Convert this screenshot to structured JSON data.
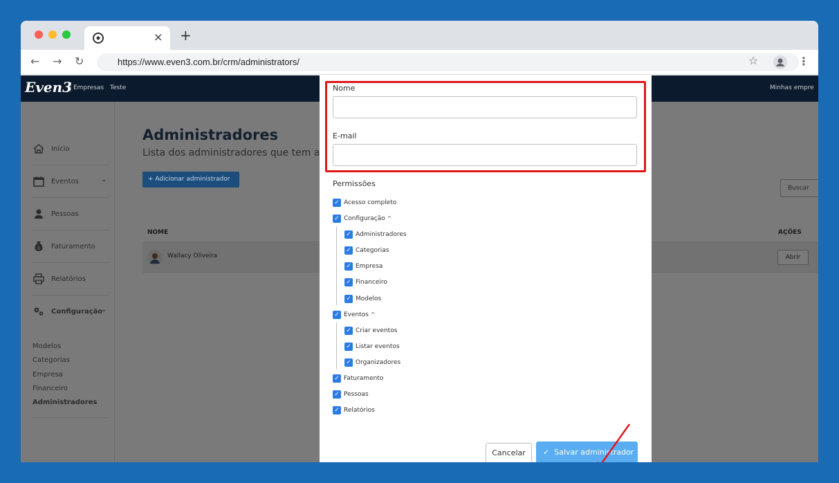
{
  "browser": {
    "url": "https://www.even3.com.br/crm/administrators/",
    "tab_close": "×",
    "new_tab": "+"
  },
  "header": {
    "logo": "Even3",
    "empresas": "Empresas",
    "teste": "Teste",
    "right_link": "Minhas empre"
  },
  "sidebar": {
    "items": [
      {
        "label": "Início",
        "icon": "home-icon"
      },
      {
        "label": "Eventos",
        "icon": "calendar-icon"
      },
      {
        "label": "Pessoas",
        "icon": "person-icon"
      },
      {
        "label": "Faturamento",
        "icon": "money-bag-icon"
      },
      {
        "label": "Relatórios",
        "icon": "printer-icon"
      },
      {
        "label": "Configuração",
        "icon": "gears-icon"
      }
    ],
    "sub_items": [
      "Modelos",
      "Categorias",
      "Empresa",
      "Financeiro",
      "Administradores"
    ]
  },
  "main": {
    "title": "Administradores",
    "subtitle": "Lista dos administradores que tem ac",
    "add_button": "+ Adicionar administrador",
    "search_button": "Buscar",
    "col_nome": "NOME",
    "col_acoes": "AÇÕES",
    "rows": [
      {
        "name": "Wallacy Oliveira",
        "action": "Abrir"
      }
    ]
  },
  "modal": {
    "nome_label": "Nome",
    "nome_value": "",
    "email_label": "E-mail",
    "email_value": "",
    "permissoes_title": "Permissões",
    "permissions": {
      "acesso_completo": "Acesso completo",
      "configuracao": "Configuração",
      "administradores": "Administradores",
      "categorias": "Categorias",
      "empresa": "Empresa",
      "financeiro": "Financeiro",
      "modelos": "Modelos",
      "eventos": "Eventos",
      "criar_eventos": "Criar eventos",
      "listar_eventos": "Listar eventos",
      "organizadores": "Organizadores",
      "faturamento": "Faturamento",
      "pessoas": "Pessoas",
      "relatorios": "Relatórios"
    },
    "cancel_button": "Cancelar",
    "save_button": "Salvar administrador"
  },
  "colors": {
    "background": "#1a6bb5",
    "checkbox": "#2c7be5",
    "save_button": "#5aadf1",
    "highlight": "#e0161b",
    "header": "#0b1a2c"
  }
}
